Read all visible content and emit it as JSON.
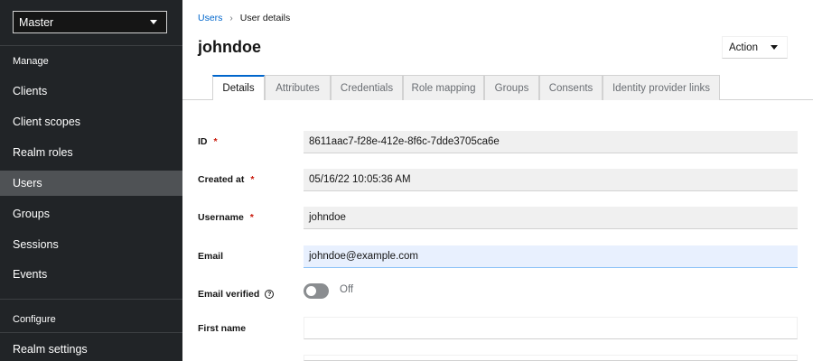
{
  "sidebar": {
    "realm": "Master",
    "sections": {
      "manage": "Manage",
      "configure": "Configure"
    },
    "items": [
      {
        "label": "Clients"
      },
      {
        "label": "Client scopes"
      },
      {
        "label": "Realm roles"
      },
      {
        "label": "Users"
      },
      {
        "label": "Groups"
      },
      {
        "label": "Sessions"
      },
      {
        "label": "Events"
      },
      {
        "label": "Realm settings"
      }
    ],
    "active": "Users"
  },
  "breadcrumb": {
    "parent": "Users",
    "current": "User details"
  },
  "header": {
    "title": "johndoe",
    "action_label": "Action"
  },
  "tabs": [
    {
      "label": "Details"
    },
    {
      "label": "Attributes"
    },
    {
      "label": "Credentials"
    },
    {
      "label": "Role mapping"
    },
    {
      "label": "Groups"
    },
    {
      "label": "Consents"
    },
    {
      "label": "Identity provider links"
    }
  ],
  "form": {
    "id": {
      "label": "ID",
      "required_mark": "*",
      "value": "8611aac7-f28e-412e-8f6c-7dde3705ca6e"
    },
    "created_at": {
      "label": "Created at",
      "required_mark": "*",
      "value": "05/16/22 10:05:36 AM"
    },
    "username": {
      "label": "Username",
      "required_mark": "*",
      "value": "johndoe"
    },
    "email": {
      "label": "Email",
      "value": "johndoe@example.com"
    },
    "email_verified": {
      "label": "Email verified",
      "help_icon": "?",
      "state": "Off"
    },
    "first_name": {
      "label": "First name",
      "value": ""
    }
  },
  "colors": {
    "sidebar_bg": "#212427",
    "active_nav": "#4f5255",
    "link": "#0066cc",
    "required": "#c9190b"
  }
}
